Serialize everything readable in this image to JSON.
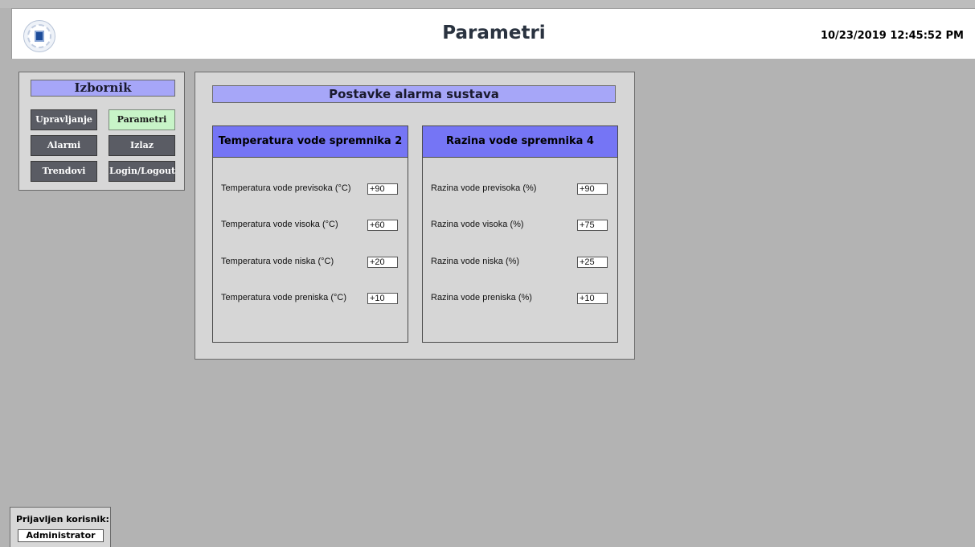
{
  "header": {
    "title": "Parametri",
    "datetime": "10/23/2019 12:45:52 PM",
    "logo_icon": "institution-seal-icon"
  },
  "menu": {
    "title": "Izbornik",
    "buttons": [
      {
        "label": "Upravljanje",
        "active": false
      },
      {
        "label": "Parametri",
        "active": true
      },
      {
        "label": "Alarmi",
        "active": false
      },
      {
        "label": "Izlaz",
        "active": false
      },
      {
        "label": "Trendovi",
        "active": false
      },
      {
        "label": "Login/Logout",
        "active": false
      }
    ]
  },
  "main": {
    "title": "Postavke alarma sustava",
    "temperature": {
      "heading": "Temperatura vode spremnika 2",
      "rows": [
        {
          "label": "Temperatura vode previsoka (°C)",
          "value": "+90"
        },
        {
          "label": "Temperatura vode visoka (°C)",
          "value": "+60"
        },
        {
          "label": "Temperatura vode niska (°C)",
          "value": "+20"
        },
        {
          "label": "Temperatura vode preniska (°C)",
          "value": "+10"
        }
      ]
    },
    "level": {
      "heading": "Razina vode spremnika 4",
      "rows": [
        {
          "label": "Razina vode previsoka (%)",
          "value": "+90"
        },
        {
          "label": "Razina vode visoka (%)",
          "value": "+75"
        },
        {
          "label": "Razina vode niska (%)",
          "value": "+25"
        },
        {
          "label": "Razina vode preniska (%)",
          "value": "+10"
        }
      ]
    }
  },
  "user": {
    "label": "Prijavljen korisnik:",
    "name": "Administrator"
  },
  "colors": {
    "background": "#b3b3b3",
    "panel": "#d6d6d6",
    "title_bar": "#a6a6f8",
    "section_header": "#7575f5",
    "menu_button": "#5a5c64",
    "menu_button_active": "#c8f4c8"
  }
}
